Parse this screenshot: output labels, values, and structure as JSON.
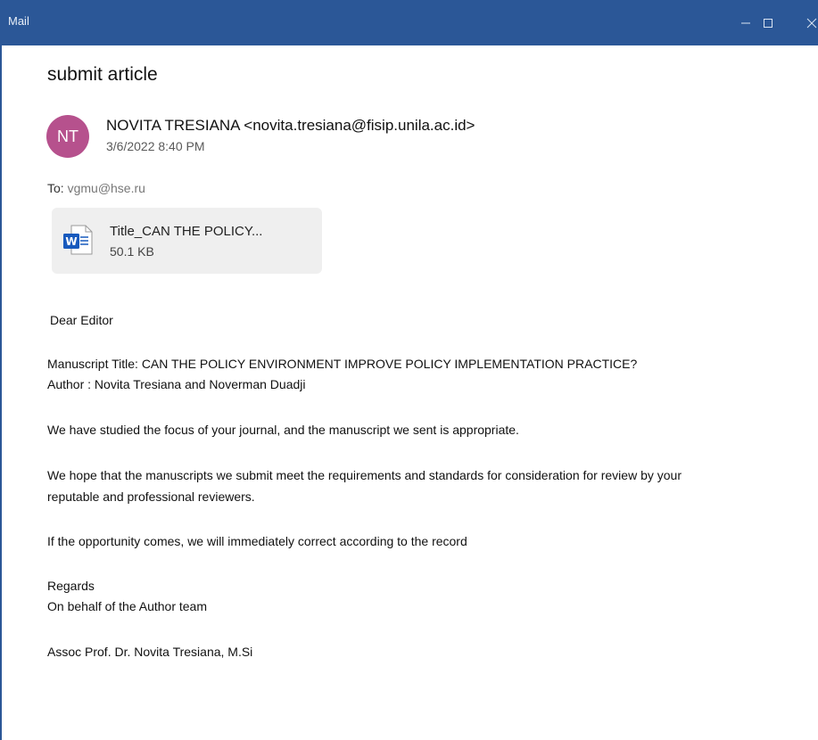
{
  "window": {
    "title": "Mail",
    "controls": {
      "minimize": "–",
      "maximize": "☐",
      "close": "✕"
    }
  },
  "message": {
    "subject": "submit article",
    "sender": {
      "initials": "NT",
      "display": "NOVITA TRESIANA <novita.tresiana@fisip.unila.ac.id>",
      "avatar_color": "#b6518d"
    },
    "date": "3/6/2022 8:40 PM",
    "to_label": "To:",
    "to_address": "vgmu@hse.ru",
    "attachment": {
      "name": "Title_CAN THE POLICY...",
      "size": "50.1 KB",
      "icon": "word-document-icon"
    },
    "body": {
      "greeting": "Dear Editor",
      "title_line": "Manuscript Title: CAN THE POLICY ENVIRONMENT IMPROVE POLICY IMPLEMENTATION PRACTICE?",
      "author_line": "Author : Novita Tresiana and Noverman Duadji",
      "para1": "We have studied the focus of your journal, and the manuscript we sent is appropriate.",
      "para2_line1": "We hope that the manuscripts we submit meet the requirements and standards for consideration for review by your",
      "para2_line2": "reputable and professional reviewers.",
      "para3": "If the opportunity comes, we will immediately correct according to the record",
      "regards": "Regards",
      "behalf": "On behalf of the Author team",
      "signature": "Assoc Prof. Dr. Novita Tresiana, M.Si"
    }
  },
  "colors": {
    "titlebar": "#2b5797",
    "attachment_bg": "#efefef",
    "word_blue": "#185abd"
  }
}
